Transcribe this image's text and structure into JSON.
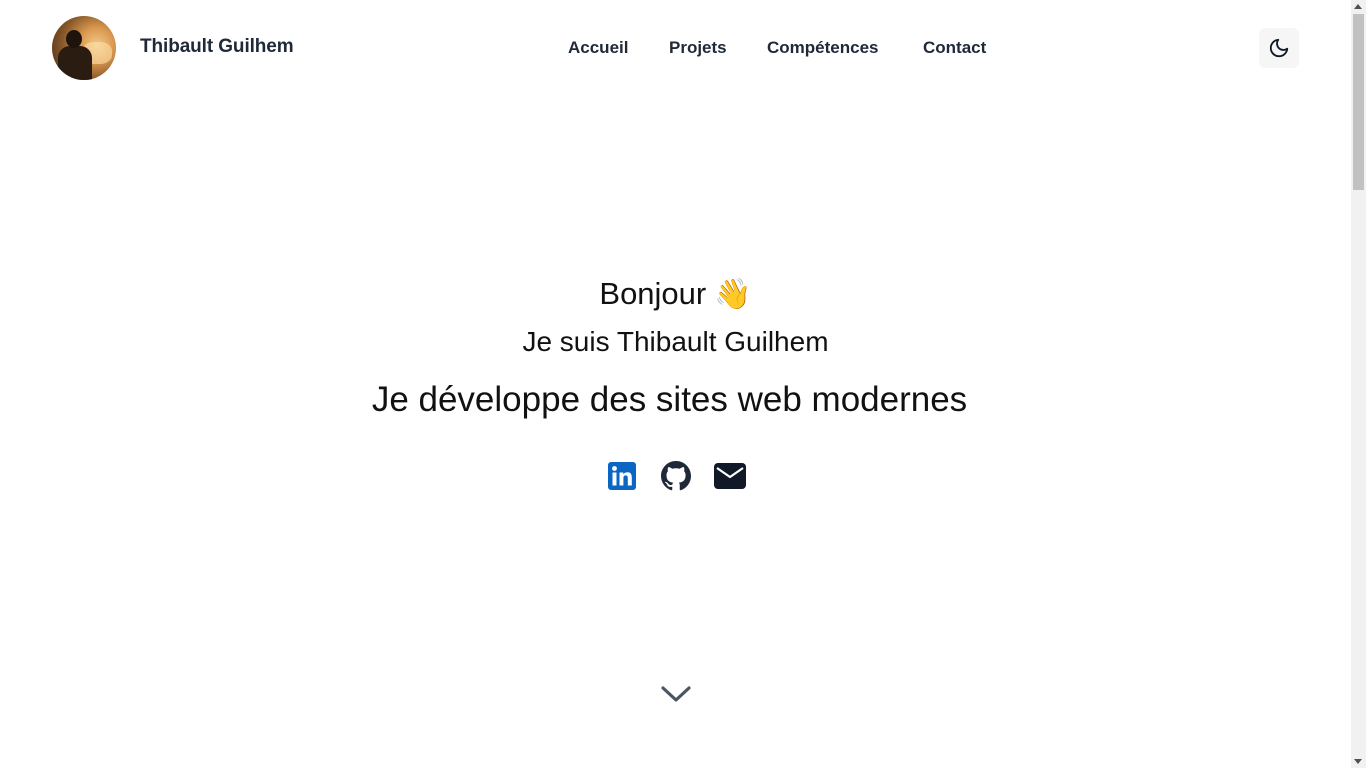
{
  "header": {
    "site_name": "Thibault Guilhem",
    "avatar_icon": "profile-photo",
    "nav": [
      {
        "label": "Accueil"
      },
      {
        "label": "Projets"
      },
      {
        "label": "Compétences"
      },
      {
        "label": "Contact"
      }
    ],
    "theme_toggle_icon": "moon-icon"
  },
  "hero": {
    "greeting": "Bonjour",
    "wave_emoji": "👋",
    "intro": "Je suis Thibault Guilhem",
    "tagline": "Je développe des sites web modernes",
    "socials": [
      {
        "icon": "linkedin-icon",
        "color": "#0a66c2"
      },
      {
        "icon": "github-icon",
        "color": "#1f2937"
      },
      {
        "icon": "mail-icon",
        "color": "#111827"
      }
    ],
    "scroll_icon": "chevron-down-icon"
  },
  "colors": {
    "text": "#1f2937",
    "linkedin": "#0a66c2",
    "background": "#ffffff"
  }
}
